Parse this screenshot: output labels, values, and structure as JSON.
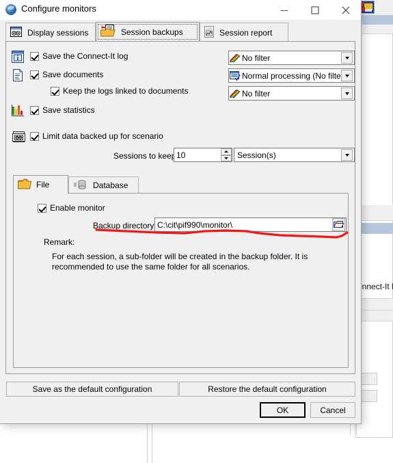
{
  "window": {
    "title": "Configure monitors",
    "icon": "connect-it-globe-icon",
    "minimize_label": "—",
    "maximize_label": "□",
    "close_label": "✕"
  },
  "tabs": [
    {
      "label": "Display sessions",
      "icon": "display-sessions-icon",
      "active": false
    },
    {
      "label": "Session backups",
      "icon": "session-backups-icon",
      "active": true
    },
    {
      "label": "Session report",
      "icon": "session-report-icon",
      "active": false
    }
  ],
  "options": {
    "save_log": {
      "label": "Save the Connect-It log",
      "checked": true,
      "icon": "info-window-icon"
    },
    "save_documents": {
      "label": "Save documents",
      "checked": true,
      "icon": "document-icon"
    },
    "keep_logs_linked": {
      "label": "Keep the logs linked to documents",
      "checked": true
    },
    "save_statistics": {
      "label": "Save statistics",
      "checked": true,
      "icon": "bar-chart-icon"
    },
    "limit_data": {
      "label": "Limit data backed up for scenario",
      "checked": true,
      "icon": "database-monitor-icon"
    }
  },
  "filters": {
    "log_filter": {
      "value": "No filter",
      "icon": "filter-brushes-icon"
    },
    "document_filter": {
      "value": "Normal processing (No filter)",
      "icon": "processing-check-icon"
    },
    "statistics_filter": {
      "value": "No filter",
      "icon": "filter-brushes-icon"
    }
  },
  "sessions": {
    "label": "Sessions to keep:",
    "value": "10",
    "unit": "Session(s)"
  },
  "inner_tabs": [
    {
      "label": "File",
      "icon": "folder-icon",
      "active": true
    },
    {
      "label": "Database",
      "icon": "database-cylinder-icon",
      "active": false
    }
  ],
  "file_panel": {
    "enable_monitor": {
      "label": "Enable monitor",
      "checked": true
    },
    "backup_directory_label": "Backup directory:",
    "backup_directory_value": "C:\\cit\\pif990\\monitor\\",
    "browse_icon": "folder-browse-icon",
    "remark_label": "Remark:",
    "remark_text": "For each session, a sub-folder will be created in the backup folder. It is recommended to use the same folder for all scenarios."
  },
  "buttons": {
    "save_default": "Save as the default configuration",
    "restore_default": "Restore the default configuration",
    "ok": "OK",
    "cancel": "Cancel"
  },
  "background": {
    "partial_text": "onnect-It lo",
    "toolbar_icon": "connect-it-toolbar-icon"
  },
  "colors": {
    "dialog_bg": "#f0f0f0",
    "titlebar_bg": "#ffffff",
    "field_bg": "#ffffff",
    "border": "#9a9a9a",
    "annotation_red": "#f41616",
    "highlight_blue": "#b6c7dc"
  }
}
